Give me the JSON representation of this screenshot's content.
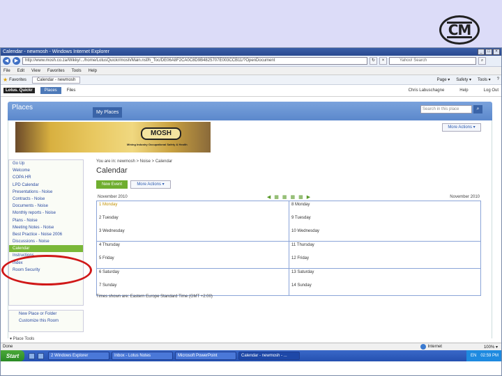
{
  "logo": {
    "text": "CM"
  },
  "browser": {
    "title": "Calendar - newmosh - Windows Internet Explorer",
    "address": "http://www.mosh.co.za/Wikky/.../home/LotusQuickr/mosh/Main.nsf/h_Toc/DE06A8F2CA0C8D9B4825707E003CCB11/?OpenDocument",
    "search_placeholder": "Yahoo! Search",
    "menu": [
      "File",
      "Edit",
      "View",
      "Favorites",
      "Tools",
      "Help"
    ],
    "favorites_label": "Favorites",
    "tab_label": "Calendar - newmosh",
    "tools": [
      "Page ▾",
      "Safety ▾",
      "Tools ▾",
      "?"
    ]
  },
  "quickr": {
    "logo": "Lotus. Quickr",
    "places_btn": "Places",
    "files_link": "Files",
    "user": "Chris Labuschagne",
    "help": "Help",
    "logout": "Log Out"
  },
  "places": {
    "title": "Places",
    "my_places": "My Places",
    "search_placeholder": "Search in this place",
    "more_actions": "More Actions ▾",
    "banner_logo": "MOSH",
    "banner_sub": "Mining Industry Occupational Safety & Health"
  },
  "nav": {
    "items": [
      {
        "label": "Go Up",
        "active": false
      },
      {
        "label": "Welcome",
        "active": false
      },
      {
        "label": "COPA HR",
        "active": false
      },
      {
        "label": "LPD Calendar",
        "active": false
      },
      {
        "label": "Presentations - Noise",
        "active": false
      },
      {
        "label": "Contracts - Noise",
        "active": false
      },
      {
        "label": "Documents - Noise",
        "active": false
      },
      {
        "label": "Monthly reports - Noise",
        "active": false
      },
      {
        "label": "Plans - Noise",
        "active": false
      },
      {
        "label": "Meeting Notes - Noise",
        "active": false
      },
      {
        "label": "Best Practice - Noise 2006",
        "active": false
      },
      {
        "label": "Discussions - Noise",
        "active": false
      },
      {
        "label": "Calendar",
        "active": true
      },
      {
        "label": "Instructions",
        "active": false
      },
      {
        "label": "Index",
        "active": false
      },
      {
        "label": "Room Security",
        "active": false
      }
    ],
    "tools": [
      {
        "label": "New Place or Folder"
      },
      {
        "label": "Customize this Room"
      }
    ],
    "place_tools": "▾ Place Tools"
  },
  "calendar": {
    "breadcrumb": "You are in: newmosh > Noise > Calendar",
    "title": "Calendar",
    "new_event": "New Event",
    "more_actions": "More Actions ▾",
    "month_left": "November 2010",
    "month_right": "November 2010",
    "weeks": [
      {
        "left": [
          "1 Monday",
          "2 Tuesday",
          "3 Wednesday"
        ],
        "right": [
          "8 Monday",
          "9 Tuesday",
          "10 Wednesday"
        ]
      },
      {
        "left": [
          "4 Thursday",
          "5 Friday"
        ],
        "right": [
          "11 Thursday",
          "12 Friday"
        ]
      },
      {
        "left": [
          "6 Saturday",
          "7 Sunday"
        ],
        "right": [
          "13 Saturday",
          "14 Sunday"
        ]
      }
    ],
    "timezone": "Times shown are: Eastern Europe Standard Time (GMT +2:00)"
  },
  "status": {
    "left": "Done",
    "zone": "Internet",
    "zoom": "100% ▾"
  },
  "taskbar": {
    "start": "Start",
    "buttons": [
      {
        "label": "2 Windows Explorer",
        "active": false
      },
      {
        "label": "Inbox - Lotus Notes",
        "active": false
      },
      {
        "label": "Microsoft PowerPoint",
        "active": false
      },
      {
        "label": "Calendar - newmosh - ...",
        "active": true
      }
    ],
    "tray": [
      "EN",
      "02:59 PM"
    ]
  }
}
